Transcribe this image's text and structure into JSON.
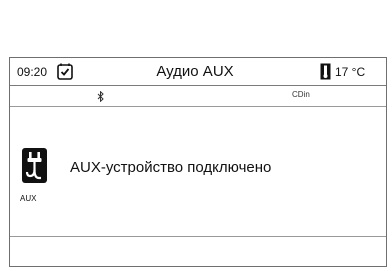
{
  "status_bar": {
    "time": "09:20",
    "title": "Аудио AUX",
    "temperature": "17 °C"
  },
  "source_bar": {
    "bluetooth_icon": "bluetooth-icon",
    "cd_in_label": "CDin"
  },
  "main": {
    "aux_icon": "aux-cable-icon",
    "aux_label": "AUX",
    "message": "AUX-устройство подключено"
  },
  "icons": {
    "clock": "clock-icon",
    "thermometer": "thermometer-icon"
  }
}
